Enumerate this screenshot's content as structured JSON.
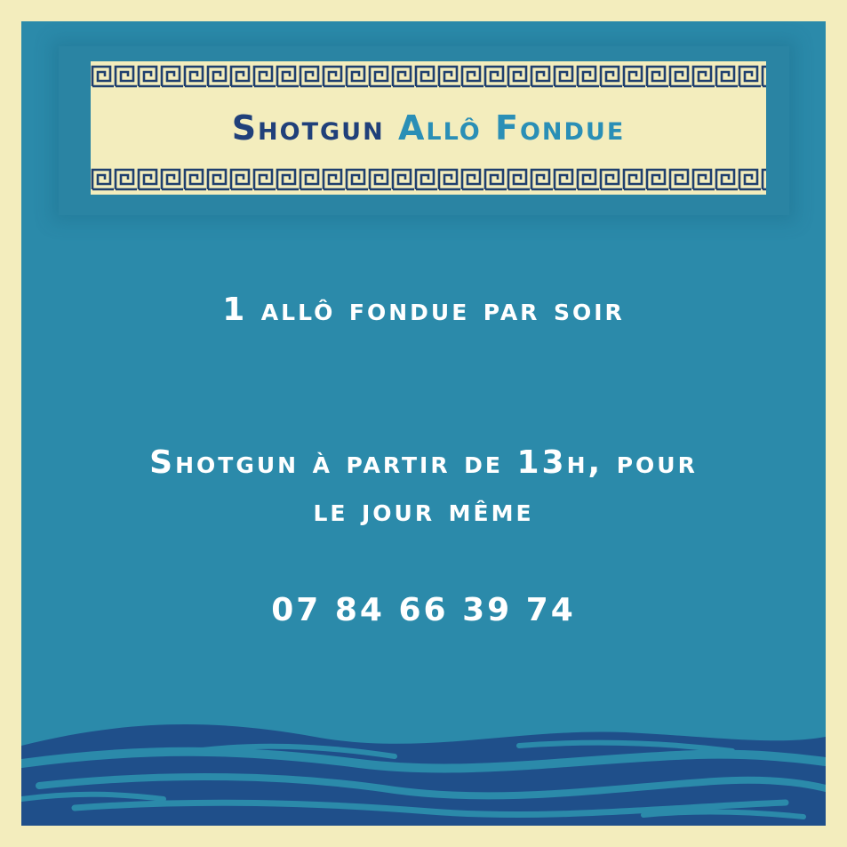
{
  "banner": {
    "title_part1": "Shotgun",
    "title_part2": "Allô",
    "title_part3": "Fondue"
  },
  "body": {
    "line1": "1 allô fondue par soir",
    "line2": "Shotgun à partir de 13h, pour",
    "line3": "le jour même",
    "phone": "07 84 66 39 74"
  },
  "colors": {
    "background_border": "#f3edbd",
    "panel_blue": "#2b8aaa",
    "dark_navy": "#20407a",
    "wave_dark": "#1f4f8a",
    "text_white": "#ffffff"
  }
}
